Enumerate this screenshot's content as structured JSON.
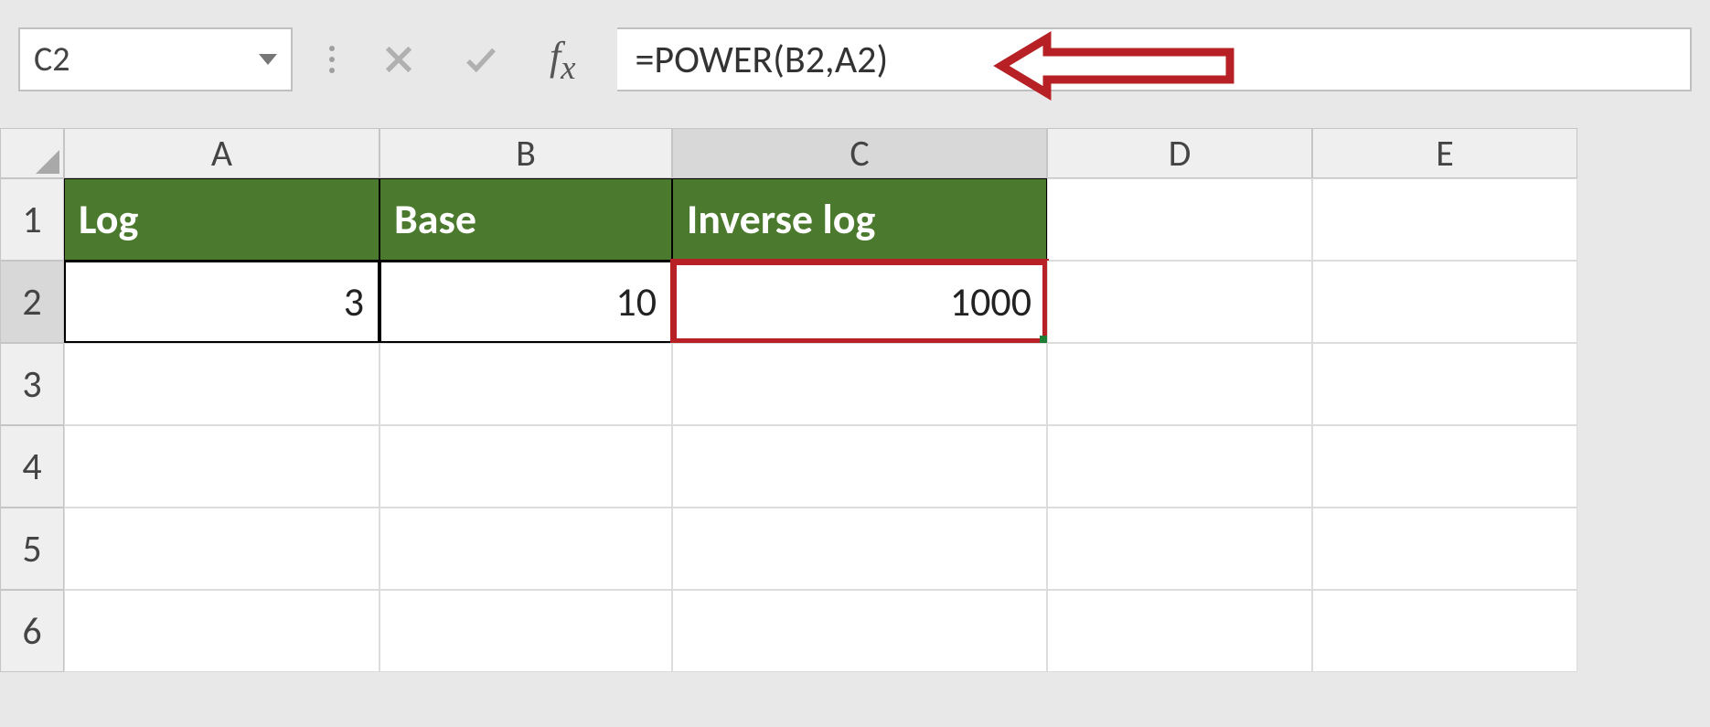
{
  "formula_bar": {
    "name_box": "C2",
    "formula": "=POWER(B2,A2)"
  },
  "columns": [
    "A",
    "B",
    "C",
    "D",
    "E"
  ],
  "rows": [
    "1",
    "2",
    "3",
    "4",
    "5",
    "6"
  ],
  "headers": {
    "A": "Log",
    "B": "Base",
    "C": "Inverse log"
  },
  "data_row2": {
    "A": "3",
    "B": "10",
    "C": "1000"
  },
  "selected_cell": "C2"
}
